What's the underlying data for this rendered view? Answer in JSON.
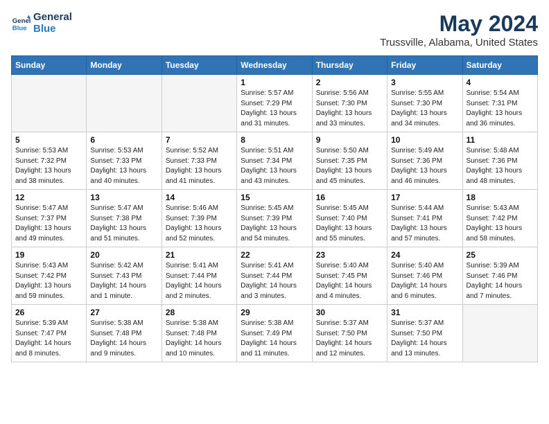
{
  "logo": {
    "line1": "General",
    "line2": "Blue"
  },
  "title": "May 2024",
  "subtitle": "Trussville, Alabama, United States",
  "weekdays": [
    "Sunday",
    "Monday",
    "Tuesday",
    "Wednesday",
    "Thursday",
    "Friday",
    "Saturday"
  ],
  "weeks": [
    [
      {
        "day": "",
        "empty": true
      },
      {
        "day": "",
        "empty": true
      },
      {
        "day": "",
        "empty": true
      },
      {
        "day": "1",
        "sunrise": "5:57 AM",
        "sunset": "7:29 PM",
        "daylight": "13 hours and 31 minutes."
      },
      {
        "day": "2",
        "sunrise": "5:56 AM",
        "sunset": "7:30 PM",
        "daylight": "13 hours and 33 minutes."
      },
      {
        "day": "3",
        "sunrise": "5:55 AM",
        "sunset": "7:30 PM",
        "daylight": "13 hours and 34 minutes."
      },
      {
        "day": "4",
        "sunrise": "5:54 AM",
        "sunset": "7:31 PM",
        "daylight": "13 hours and 36 minutes."
      }
    ],
    [
      {
        "day": "5",
        "sunrise": "5:53 AM",
        "sunset": "7:32 PM",
        "daylight": "13 hours and 38 minutes."
      },
      {
        "day": "6",
        "sunrise": "5:53 AM",
        "sunset": "7:33 PM",
        "daylight": "13 hours and 40 minutes."
      },
      {
        "day": "7",
        "sunrise": "5:52 AM",
        "sunset": "7:33 PM",
        "daylight": "13 hours and 41 minutes."
      },
      {
        "day": "8",
        "sunrise": "5:51 AM",
        "sunset": "7:34 PM",
        "daylight": "13 hours and 43 minutes."
      },
      {
        "day": "9",
        "sunrise": "5:50 AM",
        "sunset": "7:35 PM",
        "daylight": "13 hours and 45 minutes."
      },
      {
        "day": "10",
        "sunrise": "5:49 AM",
        "sunset": "7:36 PM",
        "daylight": "13 hours and 46 minutes."
      },
      {
        "day": "11",
        "sunrise": "5:48 AM",
        "sunset": "7:36 PM",
        "daylight": "13 hours and 48 minutes."
      }
    ],
    [
      {
        "day": "12",
        "sunrise": "5:47 AM",
        "sunset": "7:37 PM",
        "daylight": "13 hours and 49 minutes."
      },
      {
        "day": "13",
        "sunrise": "5:47 AM",
        "sunset": "7:38 PM",
        "daylight": "13 hours and 51 minutes."
      },
      {
        "day": "14",
        "sunrise": "5:46 AM",
        "sunset": "7:39 PM",
        "daylight": "13 hours and 52 minutes."
      },
      {
        "day": "15",
        "sunrise": "5:45 AM",
        "sunset": "7:39 PM",
        "daylight": "13 hours and 54 minutes."
      },
      {
        "day": "16",
        "sunrise": "5:45 AM",
        "sunset": "7:40 PM",
        "daylight": "13 hours and 55 minutes."
      },
      {
        "day": "17",
        "sunrise": "5:44 AM",
        "sunset": "7:41 PM",
        "daylight": "13 hours and 57 minutes."
      },
      {
        "day": "18",
        "sunrise": "5:43 AM",
        "sunset": "7:42 PM",
        "daylight": "13 hours and 58 minutes."
      }
    ],
    [
      {
        "day": "19",
        "sunrise": "5:43 AM",
        "sunset": "7:42 PM",
        "daylight": "13 hours and 59 minutes."
      },
      {
        "day": "20",
        "sunrise": "5:42 AM",
        "sunset": "7:43 PM",
        "daylight": "14 hours and 1 minute."
      },
      {
        "day": "21",
        "sunrise": "5:41 AM",
        "sunset": "7:44 PM",
        "daylight": "14 hours and 2 minutes."
      },
      {
        "day": "22",
        "sunrise": "5:41 AM",
        "sunset": "7:44 PM",
        "daylight": "14 hours and 3 minutes."
      },
      {
        "day": "23",
        "sunrise": "5:40 AM",
        "sunset": "7:45 PM",
        "daylight": "14 hours and 4 minutes."
      },
      {
        "day": "24",
        "sunrise": "5:40 AM",
        "sunset": "7:46 PM",
        "daylight": "14 hours and 6 minutes."
      },
      {
        "day": "25",
        "sunrise": "5:39 AM",
        "sunset": "7:46 PM",
        "daylight": "14 hours and 7 minutes."
      }
    ],
    [
      {
        "day": "26",
        "sunrise": "5:39 AM",
        "sunset": "7:47 PM",
        "daylight": "14 hours and 8 minutes."
      },
      {
        "day": "27",
        "sunrise": "5:38 AM",
        "sunset": "7:48 PM",
        "daylight": "14 hours and 9 minutes."
      },
      {
        "day": "28",
        "sunrise": "5:38 AM",
        "sunset": "7:48 PM",
        "daylight": "14 hours and 10 minutes."
      },
      {
        "day": "29",
        "sunrise": "5:38 AM",
        "sunset": "7:49 PM",
        "daylight": "14 hours and 11 minutes."
      },
      {
        "day": "30",
        "sunrise": "5:37 AM",
        "sunset": "7:50 PM",
        "daylight": "14 hours and 12 minutes."
      },
      {
        "day": "31",
        "sunrise": "5:37 AM",
        "sunset": "7:50 PM",
        "daylight": "14 hours and 13 minutes."
      },
      {
        "day": "",
        "empty": true
      }
    ]
  ],
  "labels": {
    "sunrise": "Sunrise:",
    "sunset": "Sunset:",
    "daylight": "Daylight hours"
  }
}
